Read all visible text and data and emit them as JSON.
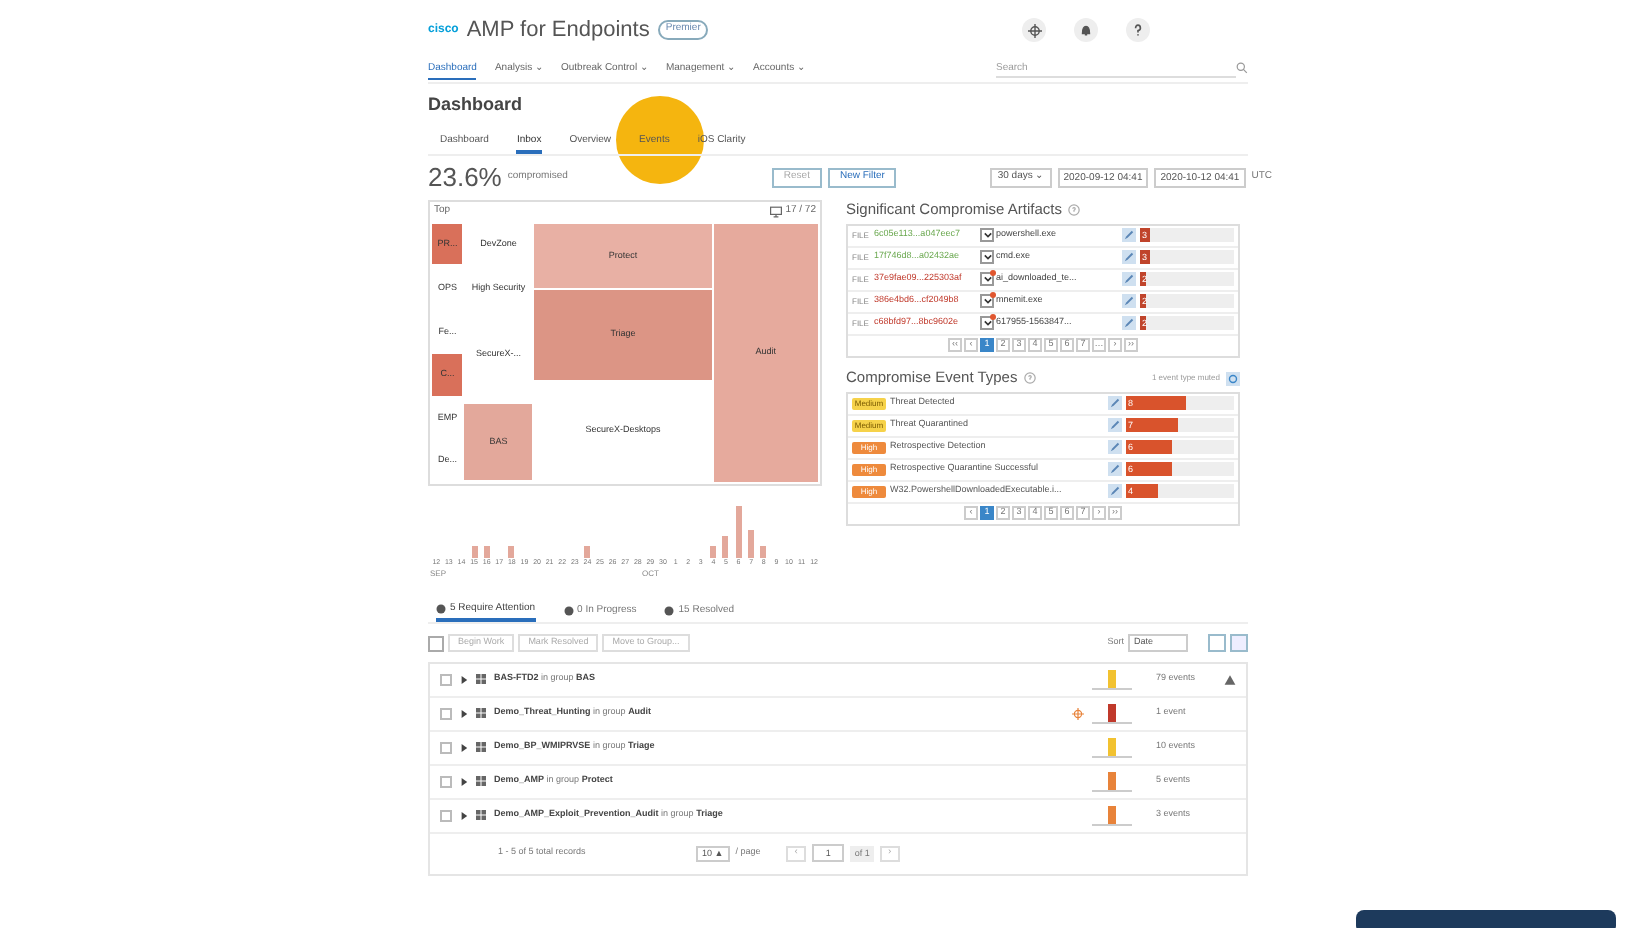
{
  "header": {
    "logo": "cisco",
    "title": "AMP for Endpoints",
    "badge": "Premier"
  },
  "nav": {
    "items": [
      {
        "label": "Dashboard",
        "selected": true
      },
      {
        "label": "Analysis ⌄",
        "selected": false
      },
      {
        "label": "Outbreak Control ⌄",
        "selected": false
      },
      {
        "label": "Management ⌄",
        "selected": false
      },
      {
        "label": "Accounts ⌄",
        "selected": false
      }
    ],
    "search": {
      "placeholder": "Search"
    }
  },
  "page_title": "Dashboard",
  "tabs": [
    {
      "label": "Dashboard",
      "selected": false
    },
    {
      "label": "Inbox",
      "selected": true
    },
    {
      "label": "Overview",
      "selected": false
    },
    {
      "label": "Events",
      "selected": false
    },
    {
      "label": "iOS Clarity",
      "selected": false
    }
  ],
  "summary": {
    "percent": "23.6%",
    "label": "compromised",
    "buttons": [
      "Reset",
      "New Filter"
    ],
    "range": "30 days ⌄",
    "start": "2020-09-12 04:41",
    "end": "2020-10-12 04:41",
    "tz": "UTC"
  },
  "treemap": {
    "title": "Top",
    "count": "17 / 72",
    "cells": [
      {
        "label": "PR...",
        "color": "#d9705a"
      },
      {
        "label": "DevZone",
        "color": "#ffffff"
      },
      {
        "label": "OPS",
        "color": "#ffffff"
      },
      {
        "label": "High Security",
        "color": "#ffffff"
      },
      {
        "label": "Fe...",
        "color": "#ffffff"
      },
      {
        "label": "C...",
        "color": "#d9705a"
      },
      {
        "label": "SecureX-...",
        "color": "#ffffff"
      },
      {
        "label": "EMP",
        "color": "#ffffff"
      },
      {
        "label": "De...",
        "color": "#ffffff"
      },
      {
        "label": "BAS",
        "color": "#e3a89b"
      },
      {
        "label": "Protect",
        "color": "#e8b0a4"
      },
      {
        "label": "Triage",
        "color": "#dc9585"
      },
      {
        "label": "Audit",
        "color": "#e6aa9d"
      },
      {
        "label": "SecureX-Desktops",
        "color": "#ffffff"
      }
    ]
  },
  "histogram": {
    "days": [
      "12",
      "13",
      "14",
      "15",
      "16",
      "17",
      "18",
      "19",
      "20",
      "21",
      "22",
      "23",
      "24",
      "25",
      "26",
      "27",
      "28",
      "29",
      "30",
      "1",
      "2",
      "3",
      "4",
      "5",
      "6",
      "7",
      "8",
      "9",
      "10",
      "11",
      "12"
    ],
    "months": [
      "SEP",
      "OCT"
    ]
  },
  "artifacts": {
    "title": "Significant Compromise Artifacts",
    "rows": [
      {
        "type": "FILE",
        "hash": "6c05e113...a047eec7",
        "kind": "clean",
        "alert": false,
        "name": "powershell.exe",
        "count": "3",
        "level": 0.1
      },
      {
        "type": "FILE",
        "hash": "17f746d8...a02432ae",
        "kind": "clean",
        "alert": false,
        "name": "cmd.exe",
        "count": "3",
        "level": 0.1
      },
      {
        "type": "FILE",
        "hash": "37e9fae09...225303af",
        "kind": "malicious",
        "alert": true,
        "name": "ai_downloaded_te...",
        "count": "2",
        "level": 0.07
      },
      {
        "type": "FILE",
        "hash": "386e4bd6...cf2049b8",
        "kind": "malicious",
        "alert": true,
        "name": "mnemit.exe",
        "count": "2",
        "level": 0.07
      },
      {
        "type": "FILE",
        "hash": "c68bfd97...8bc9602e",
        "kind": "malicious",
        "alert": true,
        "name": "617955-1563847...",
        "count": "2",
        "level": 0.07
      }
    ],
    "pages": [
      {
        "label": "‹‹",
        "selected": false
      },
      {
        "label": "‹",
        "selected": false
      },
      {
        "label": "1",
        "selected": true
      },
      {
        "label": "2",
        "selected": false
      },
      {
        "label": "3",
        "selected": false
      },
      {
        "label": "4",
        "selected": false
      },
      {
        "label": "5",
        "selected": false
      },
      {
        "label": "6",
        "selected": false
      },
      {
        "label": "7",
        "selected": false
      },
      {
        "label": "…",
        "selected": false
      },
      {
        "label": "›",
        "selected": false
      },
      {
        "label": "››",
        "selected": false
      }
    ]
  },
  "event_types": {
    "title": "Compromise Event Types",
    "muted": "1 event type muted",
    "rows": [
      {
        "severity": "Medium",
        "name": "Threat Detected",
        "count": "8",
        "level": 0.55
      },
      {
        "severity": "Medium",
        "name": "Threat Quarantined",
        "count": "7",
        "level": 0.48
      },
      {
        "severity": "High",
        "name": "Retrospective Detection",
        "count": "6",
        "level": 0.42
      },
      {
        "severity": "High",
        "name": "Retrospective Quarantine Successful",
        "count": "6",
        "level": 0.42
      },
      {
        "severity": "High",
        "name": "W32.PowershellDownloadedExecutable.i...",
        "count": "4",
        "level": 0.3
      }
    ],
    "pages": [
      {
        "label": "‹",
        "selected": false
      },
      {
        "label": "1",
        "selected": true
      },
      {
        "label": "2",
        "selected": false
      },
      {
        "label": "3",
        "selected": false
      },
      {
        "label": "4",
        "selected": false
      },
      {
        "label": "5",
        "selected": false
      },
      {
        "label": "6",
        "selected": false
      },
      {
        "label": "7",
        "selected": false
      },
      {
        "label": "›",
        "selected": false
      },
      {
        "label": "››",
        "selected": false
      }
    ]
  },
  "inbox_tabs": [
    {
      "label": "5 Require Attention",
      "selected": true
    },
    {
      "label": "0 In Progress",
      "selected": false
    },
    {
      "label": "15 Resolved",
      "selected": false
    }
  ],
  "toolbar": {
    "select_all": {
      "checked": false
    },
    "actions": [
      "Begin Work",
      "Mark Resolved",
      "Move to Group..."
    ],
    "sort_label": "Sort",
    "sort_value": "Date"
  },
  "computers": [
    {
      "name": "BAS-FTD2",
      "in": "in group",
      "group": "BAS",
      "events": "79 events",
      "color": "#f2c230",
      "checked": false,
      "warning": true,
      "targeted": false
    },
    {
      "name": "Demo_Threat_Hunting",
      "in": "in group",
      "group": "Audit",
      "events": "1 event",
      "color": "#c0392b",
      "checked": false,
      "warning": false,
      "targeted": true
    },
    {
      "name": "Demo_BP_WMIPRVSE",
      "in": "in group",
      "group": "Triage",
      "events": "10 events",
      "color": "#f2c230",
      "checked": false,
      "warning": false,
      "targeted": false
    },
    {
      "name": "Demo_AMP",
      "in": "in group",
      "group": "Protect",
      "events": "5 events",
      "color": "#e8833a",
      "checked": false,
      "warning": false,
      "targeted": false
    },
    {
      "name": "Demo_AMP_Exploit_Prevention_Audit",
      "in": "in group",
      "group": "Triage",
      "events": "3 events",
      "color": "#e8833a",
      "checked": false,
      "warning": false,
      "targeted": false
    }
  ],
  "footer": {
    "records": "1 - 5 of 5 total records",
    "per_page": "10 ▲",
    "per_page_label": "/ page",
    "prev": "‹",
    "page": "1",
    "of": "of 1",
    "next": "›"
  }
}
